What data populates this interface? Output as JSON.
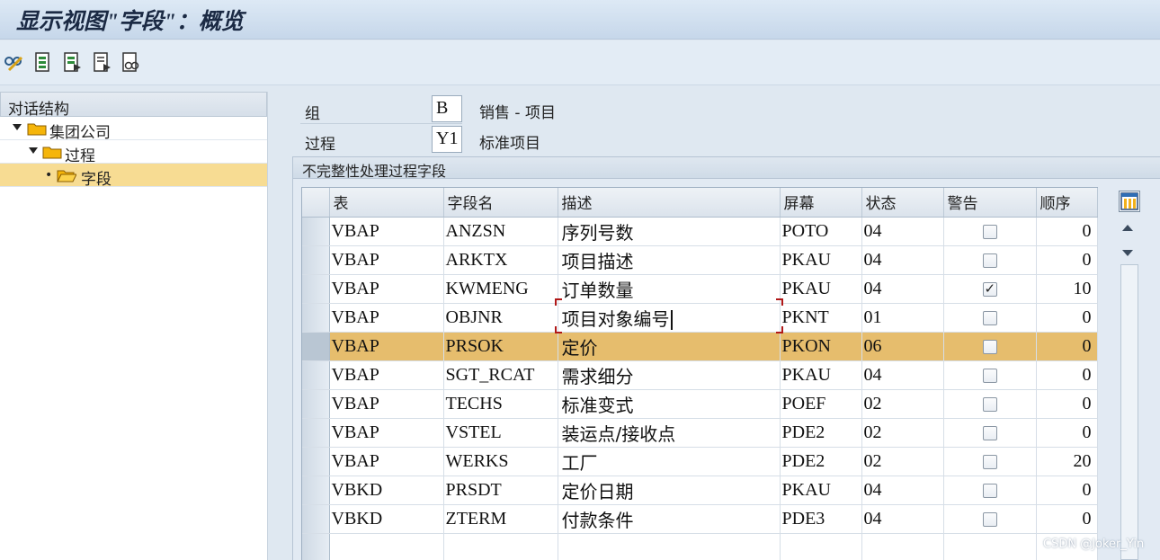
{
  "window": {
    "title": "显示视图\"字段\"：概览"
  },
  "toolbar": {
    "icons": [
      "glasses-pencil-icon",
      "document-icon",
      "document-arrow-icon",
      "document-list-icon",
      "document-search-icon"
    ]
  },
  "tree": {
    "header": "对话结构",
    "items": [
      {
        "label": "集团公司",
        "level": 0,
        "expanded": true,
        "selected": false
      },
      {
        "label": "过程",
        "level": 1,
        "expanded": true,
        "selected": false
      },
      {
        "label": "字段",
        "level": 2,
        "expanded": false,
        "selected": true
      }
    ]
  },
  "form": {
    "group_label": "组",
    "group_value": "B",
    "group_desc": "销售 - 项目",
    "proc_label": "过程",
    "proc_value": "Y1",
    "proc_desc": "标准项目"
  },
  "section": {
    "title": "不完整性处理过程字段"
  },
  "table": {
    "columns": [
      "表",
      "字段名",
      "描述",
      "屏幕",
      "状态",
      "警告",
      "顺序"
    ],
    "rows": [
      {
        "table": "VBAP",
        "field": "ANZSN",
        "desc": "序列号数",
        "screen": "POTO",
        "status": "04",
        "warning": false,
        "order": "0"
      },
      {
        "table": "VBAP",
        "field": "ARKTX",
        "desc": "项目描述",
        "screen": "PKAU",
        "status": "04",
        "warning": false,
        "order": "0"
      },
      {
        "table": "VBAP",
        "field": "KWMENG",
        "desc": "订单数量",
        "screen": "PKAU",
        "status": "04",
        "warning": true,
        "order": "10"
      },
      {
        "table": "VBAP",
        "field": "OBJNR",
        "desc": "项目对象编号",
        "screen": "PKNT",
        "status": "01",
        "warning": false,
        "order": "0"
      },
      {
        "table": "VBAP",
        "field": "PRSOK",
        "desc": "定价",
        "screen": "PKON",
        "status": "06",
        "warning": false,
        "order": "0"
      },
      {
        "table": "VBAP",
        "field": "SGT_RCAT",
        "desc": "需求细分",
        "screen": "PKAU",
        "status": "04",
        "warning": false,
        "order": "0"
      },
      {
        "table": "VBAP",
        "field": "TECHS",
        "desc": "标准变式",
        "screen": "POEF",
        "status": "02",
        "warning": false,
        "order": "0"
      },
      {
        "table": "VBAP",
        "field": "VSTEL",
        "desc": "装运点/接收点",
        "screen": "PDE2",
        "status": "02",
        "warning": false,
        "order": "0"
      },
      {
        "table": "VBAP",
        "field": "WERKS",
        "desc": "工厂",
        "screen": "PDE2",
        "status": "02",
        "warning": false,
        "order": "20"
      },
      {
        "table": "VBKD",
        "field": "PRSDT",
        "desc": "定价日期",
        "screen": "PKAU",
        "status": "04",
        "warning": false,
        "order": "0"
      },
      {
        "table": "VBKD",
        "field": "ZTERM",
        "desc": "付款条件",
        "screen": "PDE3",
        "status": "04",
        "warning": false,
        "order": "0"
      }
    ],
    "highlighted_row": 4,
    "focused_row": 3
  },
  "watermark": "CSDN @Joker_Yin",
  "colors": {
    "highlight": "#e6bd6d",
    "tree_selected": "#f7dc93",
    "background": "#dfe8f1"
  }
}
